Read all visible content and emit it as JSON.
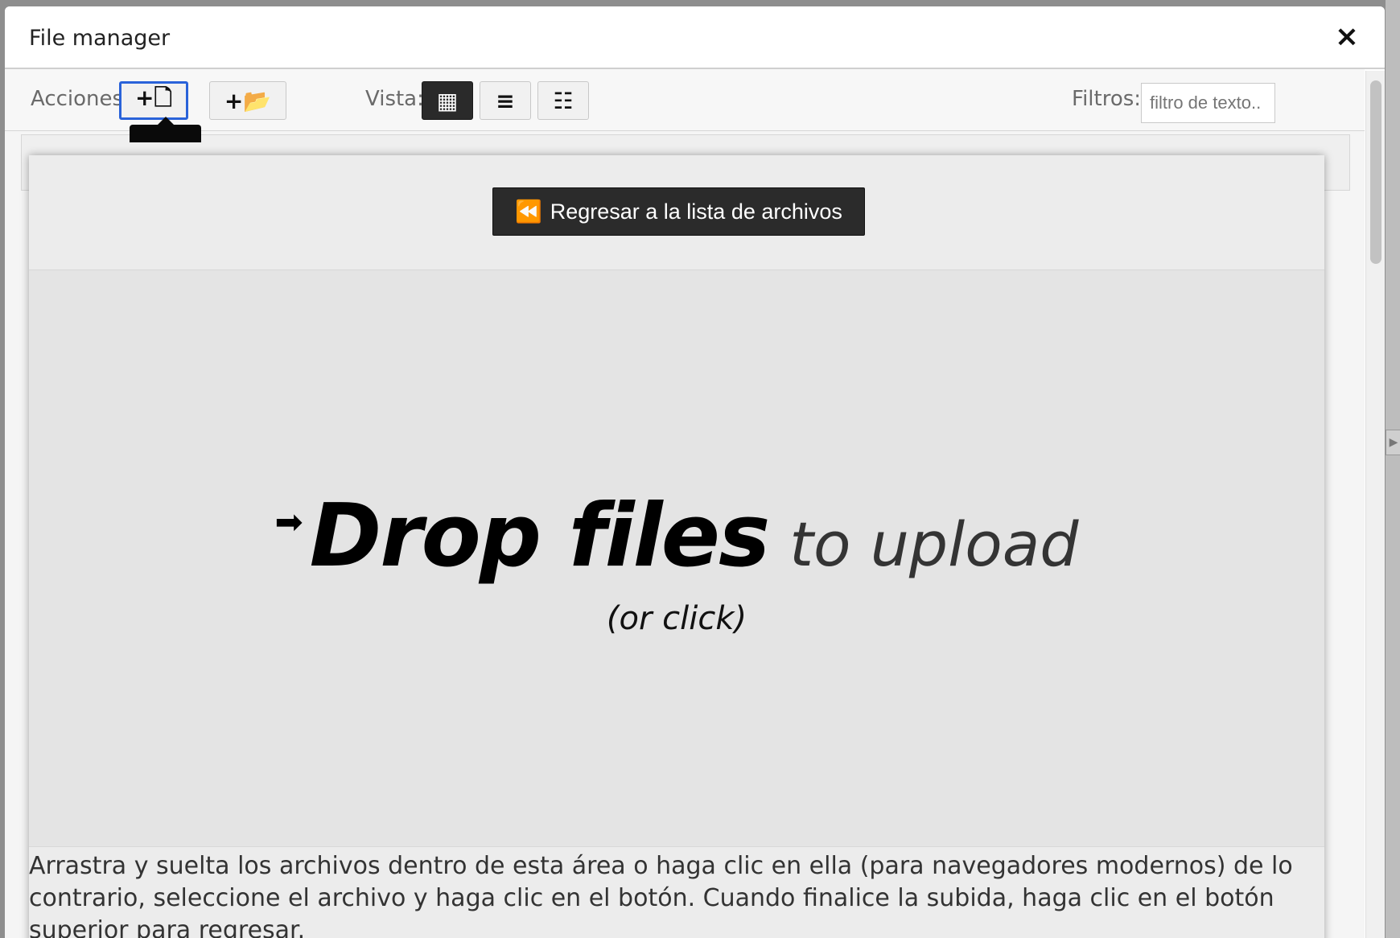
{
  "modal": {
    "title": "File manager",
    "close_icon": "×"
  },
  "toolbar": {
    "actions_label": "Acciones:",
    "view_label": "Vista:",
    "filters_label": "Filtros:",
    "filter_placeholder": "filtro de texto..",
    "buttons": {
      "add_file_icon": "+🗋",
      "add_folder_icon": "+📂",
      "view_grid_icon": "▦",
      "view_list_icon": "≡",
      "view_details_icon": "☷"
    }
  },
  "upload": {
    "back_button_label": "Regresar a la lista de archivos",
    "back_icon": "⏪",
    "drop_arrow": "➡",
    "drop_bold": "Drop files",
    "drop_light": "to upload",
    "drop_sub": "(or click)",
    "help_text": "Arrastra y suelta los archivos dentro de esta área o haga clic en ella (para navegadores modernos) de lo contrario, seleccione el archivo y haga clic en el botón. Cuando finalice la subida, haga clic en el botón superior para regresar."
  },
  "colors": {
    "focus_border": "#2962d9",
    "active_button": "#2a2a2a",
    "dropzone_bg": "#e4e4e4"
  }
}
